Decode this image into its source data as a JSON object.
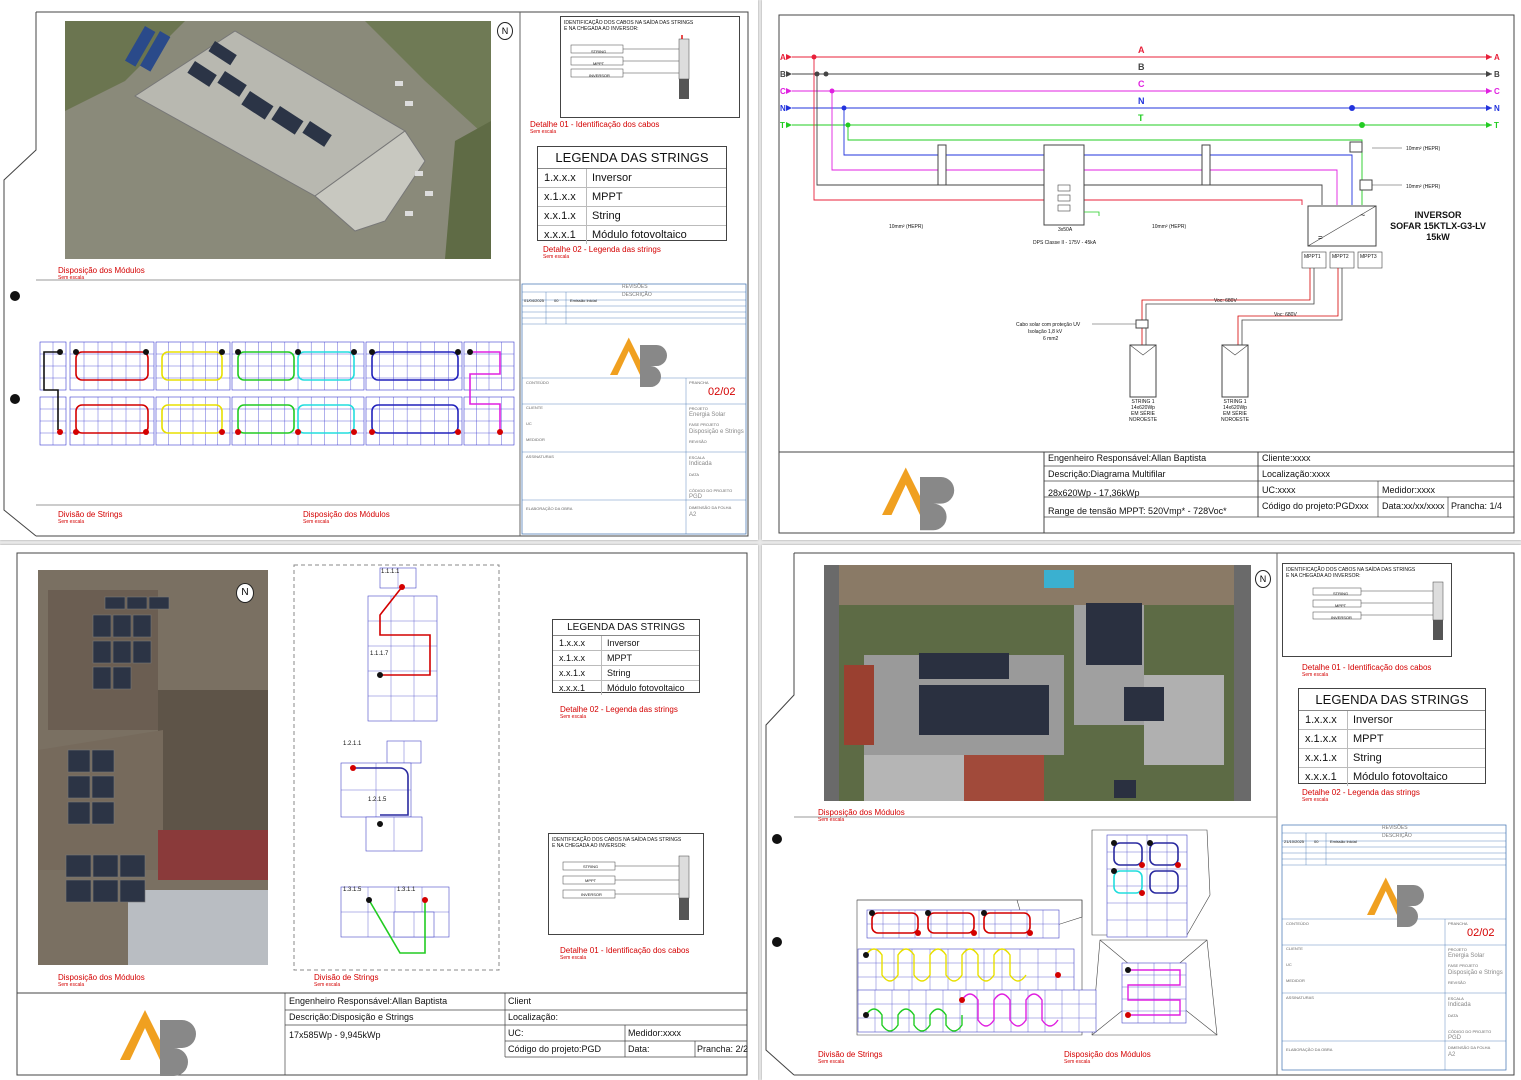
{
  "legend": {
    "title": "LEGENDA DAS STRINGS",
    "rows": [
      {
        "code": "1.x.x.x",
        "label": "Inversor"
      },
      {
        "code": "x.1.x.x",
        "label": "MPPT"
      },
      {
        "code": "x.x.1.x",
        "label": "String"
      },
      {
        "code": "x.x.x.1",
        "label": "Módulo fotovoltaico"
      }
    ]
  },
  "cable_id": {
    "title_line1": "IDENTIFICAÇÃO DOS CABOS NA SAÍDA DAS STRINGS",
    "title_line2": "E NA CHEGADA AO INVERSOR:",
    "labels": [
      "STRING",
      "MPPT",
      "INVERSOR"
    ]
  },
  "captions": {
    "detalhe01": "Detalhe 01 - Identificação dos cabos",
    "detalhe02": "Detalhe 02 - Legenda das strings",
    "detalhe01_alt": "Detalhe 01 - Identificação dos cabos",
    "detalhe02_alt": "Detalhe 02 - Legenda das strings",
    "disposicao": "Disposição dos Módulos",
    "divisao": "Divisão de Strings",
    "sem_escala": "Sem escala"
  },
  "north": "N",
  "sheet_a": {
    "prancha": "02/02",
    "revisoes": "REVISÕES",
    "descricao_hdr": "DESCRIÇÃO",
    "rev_date": "01/04/2025",
    "rev_num": "00",
    "rev_desc": "Emissão Inicial",
    "projeto": "Energia Solar",
    "fase": "Disposição e Strings",
    "escala": "Indicada",
    "codigo": "PGD",
    "dimensao": "A2"
  },
  "sheet_b": {
    "phases": [
      "A",
      "B",
      "C",
      "N",
      "T"
    ],
    "phase_colors": [
      "#e8203a",
      "#444444",
      "#e020e0",
      "#2233dd",
      "#22cc22"
    ],
    "cable_hepr": "10mm² (HEPR)",
    "dps_label1": "3x50A",
    "dps_label2": "DPS Classe II - 175V - 45kA",
    "inverter_line1": "INVERSOR",
    "inverter_line2": "SOFAR 15KTLX-G3-LV",
    "inverter_line3": "15kW",
    "mppts": [
      "MPPT1",
      "MPPT2",
      "MPPT3"
    ],
    "voc1": "Voc: 680V",
    "voc2": "Voc: 680V",
    "solar_cable_1": "Cabo solar com proteção UV",
    "solar_cable_2": "Isolação 1,8 kV",
    "solar_cable_3": "6 mm2",
    "string_lines": [
      "STRING 1",
      "14x620Wp",
      "EM SÉRIE",
      "NOROESTE"
    ],
    "tb": {
      "engenheiro": "Engenheiro Responsável:Allan Baptista",
      "descricao": "Descrição:Diagrama Multifilar",
      "potencia": "28x620Wp - 17,36kWp",
      "range": "Range de tensão MPPT: 520Vmp* - 728Voc*",
      "cliente": "Cliente:xxxx",
      "localizacao": "Localização:xxxx",
      "uc": "UC:xxxx",
      "medidor": "Medidor:xxxx",
      "codigo": "Código do projeto:PGDxxx",
      "data": "Data:xx/xx/xxxx",
      "prancha": "Prancha: 1/4"
    }
  },
  "sheet_c": {
    "labels": [
      "1.1.1.1",
      "1.1.1.7",
      "1.2.1.1",
      "1.2.1.5",
      "1.3.1.5",
      "1.3.1.1"
    ],
    "tb": {
      "engenheiro": "Engenheiro Responsável:Allan Baptista",
      "descricao": "Descrição:Disposição e Strings",
      "potencia": "17x585Wp - 9,945kWp",
      "cliente": "Client",
      "localizacao": "Localização:",
      "uc": "UC:",
      "medidor": "Medidor:xxxx",
      "codigo": "Código do projeto:PGD",
      "data": "Data:",
      "prancha": "Prancha: 2/2"
    }
  },
  "sheet_d": {
    "prancha": "02/02",
    "revisoes": "REVISÕES",
    "descricao_hdr": "DESCRIÇÃO",
    "rev_date": "21/10/2025",
    "rev_num": "00",
    "rev_desc": "Emissão Inicial",
    "projeto": "Energia Solar",
    "fase": "Disposição e Strings",
    "escala": "Indicada",
    "codigo": "PGD",
    "dimensao": "A2"
  },
  "titleblock_fields": {
    "conteudo": "CONTEÚDO",
    "cliente": "CLIENTE",
    "uc": "UC",
    "medidor": "MEDIDOR",
    "assinaturas": "ASSINATURAS",
    "projeto": "PROJETO",
    "fase": "FASE PROJETO",
    "revisao": "REVISÃO",
    "escala": "ESCALA",
    "data": "DATA",
    "codigo": "CÓDIGO DO PROJETO",
    "dimensao": "DIMENSÃO DA FOLHA",
    "prancha": "PRANCHA",
    "elaboracao": "ELABORAÇÃO DA OBRA"
  }
}
